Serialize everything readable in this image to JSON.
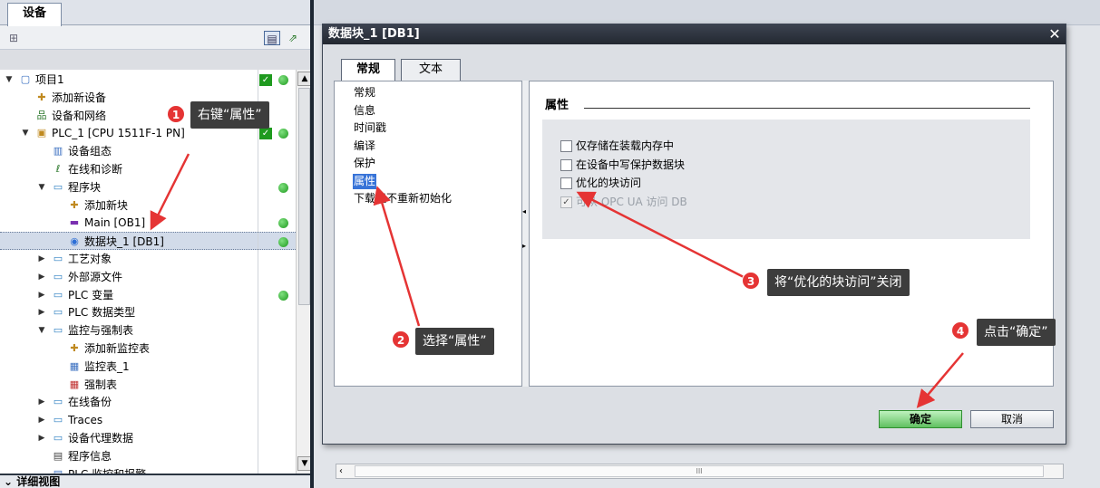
{
  "left_panel": {
    "tab_label": "设备",
    "detail_view_label": "详细视图",
    "tree": [
      {
        "label": "项目1",
        "level": 0,
        "expanded": true,
        "icon": "project-icon",
        "status_check": true,
        "status_dot": true
      },
      {
        "label": "添加新设备",
        "level": 1,
        "icon": "add-device-icon"
      },
      {
        "label": "设备和网络",
        "level": 1,
        "icon": "network-icon"
      },
      {
        "label": "PLC_1 [CPU 1511F-1 PN]",
        "level": 1,
        "expanded": true,
        "icon": "plc-icon",
        "status_check": true,
        "status_dot": true
      },
      {
        "label": "设备组态",
        "level": 2,
        "icon": "device-config-icon"
      },
      {
        "label": "在线和诊断",
        "level": 2,
        "icon": "diagnostics-icon"
      },
      {
        "label": "程序块",
        "level": 2,
        "expanded": true,
        "icon": "folder-icon",
        "status_dot": true
      },
      {
        "label": "添加新块",
        "level": 3,
        "icon": "add-block-icon"
      },
      {
        "label": "Main [OB1]",
        "level": 3,
        "icon": "ob-block-icon",
        "status_dot": true
      },
      {
        "label": "数据块_1 [DB1]",
        "level": 3,
        "icon": "db-block-icon",
        "status_dot": true,
        "selected": true
      },
      {
        "label": "工艺对象",
        "level": 2,
        "collapsed": true,
        "icon": "folder-icon"
      },
      {
        "label": "外部源文件",
        "level": 2,
        "collapsed": true,
        "icon": "folder-icon"
      },
      {
        "label": "PLC 变量",
        "level": 2,
        "collapsed": true,
        "icon": "folder-icon",
        "status_dot": true
      },
      {
        "label": "PLC 数据类型",
        "level": 2,
        "collapsed": true,
        "icon": "folder-icon"
      },
      {
        "label": "监控与强制表",
        "level": 2,
        "expanded": true,
        "icon": "folder-icon"
      },
      {
        "label": "添加新监控表",
        "level": 3,
        "icon": "add-table-icon"
      },
      {
        "label": "监控表_1",
        "level": 3,
        "icon": "watch-table-icon"
      },
      {
        "label": "强制表",
        "level": 3,
        "icon": "force-table-icon"
      },
      {
        "label": "在线备份",
        "level": 2,
        "collapsed": true,
        "icon": "folder-icon"
      },
      {
        "label": "Traces",
        "level": 2,
        "collapsed": true,
        "icon": "folder-icon"
      },
      {
        "label": "设备代理数据",
        "level": 2,
        "collapsed": true,
        "icon": "folder-icon"
      },
      {
        "label": "程序信息",
        "level": 2,
        "icon": "program-info-icon"
      },
      {
        "label": "PLC 监控和报警",
        "level": 2,
        "icon": "alarm-icon"
      }
    ]
  },
  "dialog": {
    "title": "数据块_1 [DB1]",
    "close_glyph": "✕",
    "tabs": [
      {
        "label": "常规",
        "active": true
      },
      {
        "label": "文本",
        "active": false
      }
    ],
    "nav_items": [
      {
        "label": "常规"
      },
      {
        "label": "信息"
      },
      {
        "label": "时间戳"
      },
      {
        "label": "编译"
      },
      {
        "label": "保护"
      },
      {
        "label": "属性",
        "selected": true
      },
      {
        "label": "下载但不重新初始化"
      }
    ],
    "section_title": "属性",
    "checkboxes": [
      {
        "label": "仅存储在装载内存中",
        "checked": false,
        "disabled": false
      },
      {
        "label": "在设备中写保护数据块",
        "checked": false,
        "disabled": false
      },
      {
        "label": "优化的块访问",
        "checked": false,
        "disabled": false
      },
      {
        "label": "可从 OPC UA 访问 DB",
        "checked": true,
        "disabled": true
      }
    ],
    "ok_label": "确定",
    "cancel_label": "取消"
  },
  "callouts": [
    {
      "number": "1",
      "text": "右键“属性”"
    },
    {
      "number": "2",
      "text": "选择“属性”"
    },
    {
      "number": "3",
      "text": "将“优化的块访问”关闭"
    },
    {
      "number": "4",
      "text": "点击“确定”"
    }
  ],
  "colors": {
    "callout_bg": "#3d3d3d",
    "badge_red": "#e53434",
    "arrow_red": "#e53434",
    "selection_blue": "#3874d8",
    "status_green": "#1f9a1f"
  }
}
